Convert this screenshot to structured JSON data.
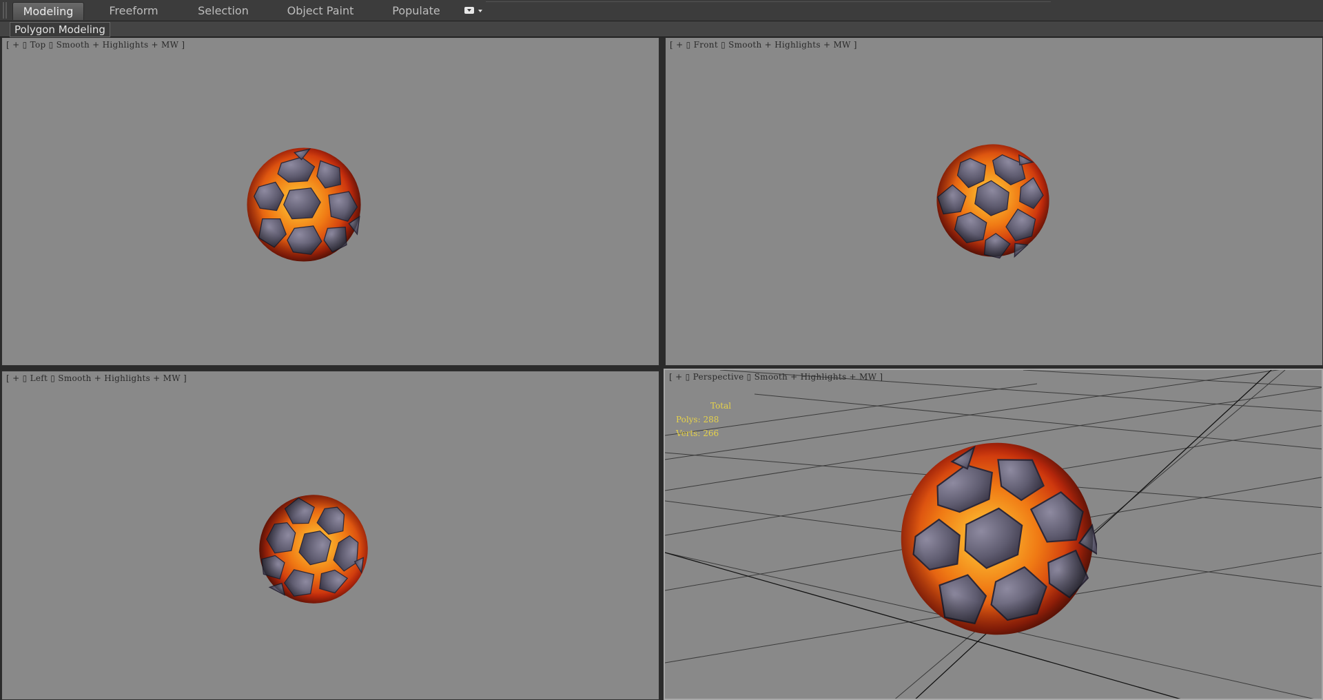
{
  "ribbon": {
    "tabs": [
      {
        "label": "Modeling",
        "active": true
      },
      {
        "label": "Freeform",
        "active": false
      },
      {
        "label": "Selection",
        "active": false
      },
      {
        "label": "Object Paint",
        "active": false
      },
      {
        "label": "Populate",
        "active": false
      }
    ],
    "overflow_icon": "dropdown-box-icon"
  },
  "panel": {
    "label": "Polygon Modeling"
  },
  "viewports": {
    "top": {
      "open": "[",
      "plus": "+",
      "view": "Top",
      "shading": "Smooth + Highlights + MW",
      "close": "]"
    },
    "front": {
      "open": "[",
      "plus": "+",
      "view": "Front",
      "shading": "Smooth + Highlights + MW",
      "close": "]"
    },
    "left": {
      "open": "[",
      "plus": "+",
      "view": "Left",
      "shading": "Smooth + Highlights + MW",
      "close": "]"
    },
    "persp": {
      "open": "[",
      "plus": "+",
      "view": "Perspective",
      "shading": "Smooth + Highlights + MW",
      "close": "]"
    }
  },
  "stats": {
    "total_label": "Total",
    "polys_label": "Polys:",
    "polys_value": "288",
    "verts_label": "Verts:",
    "verts_value": "266"
  },
  "colors": {
    "viewport_bg": "#898989",
    "lava_bright": "#ffb020",
    "lava_dark": "#c72a0c",
    "rock": "#5f5c70",
    "stat_text": "#e6d24a"
  }
}
